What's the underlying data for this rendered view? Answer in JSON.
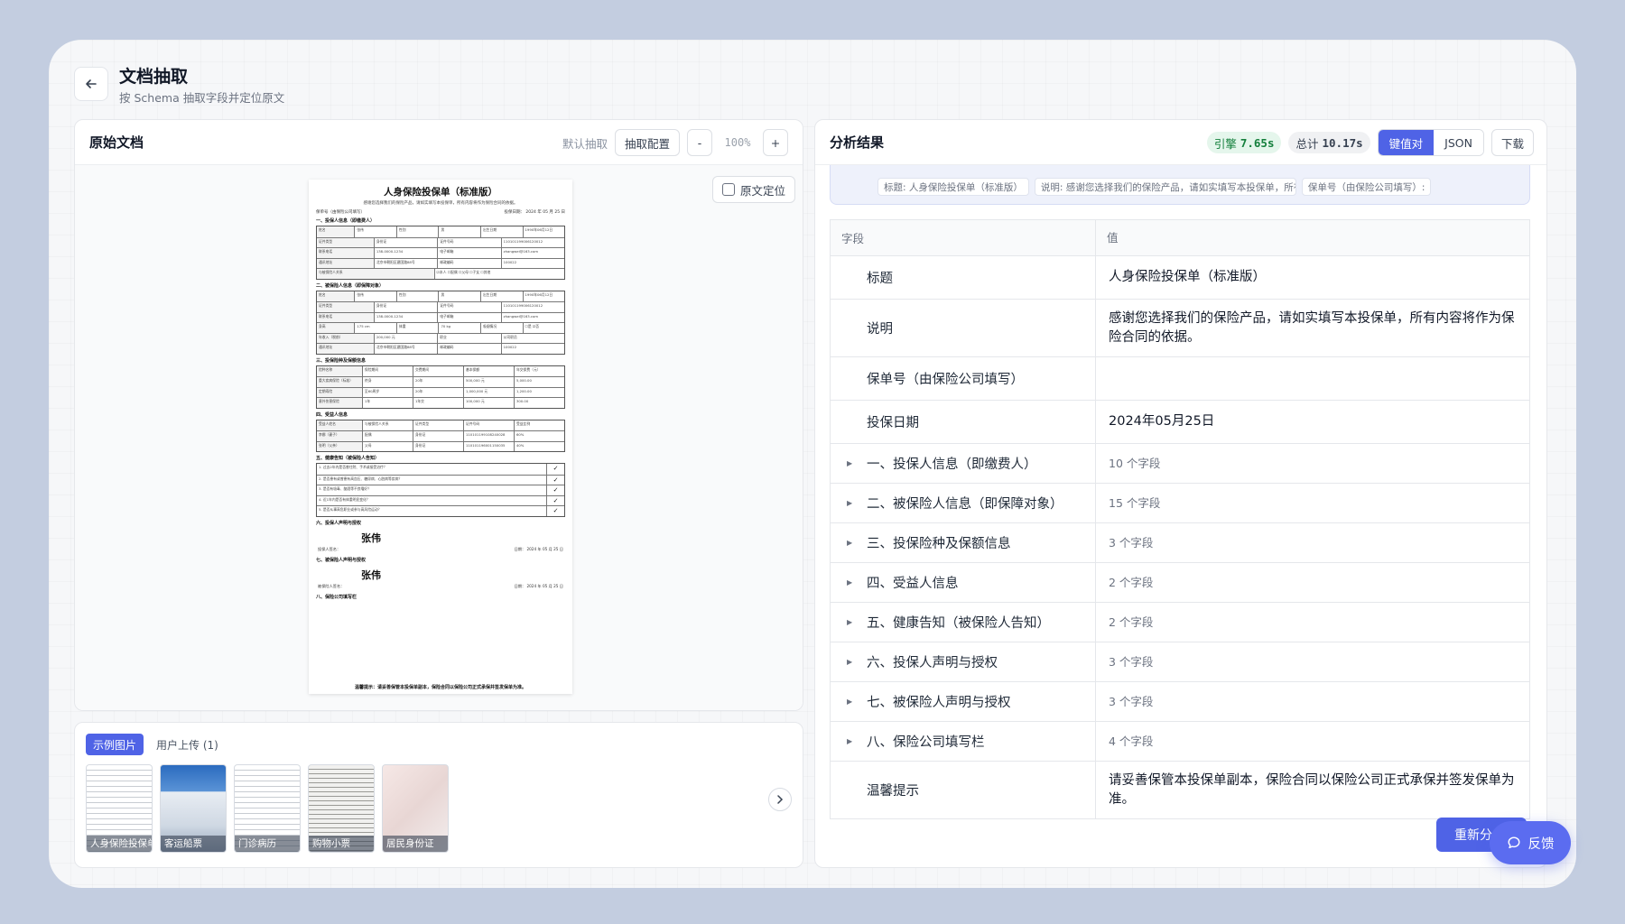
{
  "header": {
    "title": "文档抽取",
    "subtitle": "按 Schema 抽取字段并定位原文"
  },
  "left": {
    "title": "原始文档",
    "default_extract": "默认抽取",
    "config_button": "抽取配置",
    "zoom_minus": "-",
    "zoom": "100%",
    "zoom_plus": "+",
    "locate_label": "原文定位"
  },
  "doc": {
    "title": "人身保险投保单（标准版）",
    "subtitle": "感谢您选择我们的保险产品，请如实填写本投保单，所有内容将作为保险合同的依据。",
    "policy_no": "保单号（由保险公司填写）",
    "date": "投保日期：  2024 年 05 月 25 日",
    "s1": "一、投保人信息（即缴费人）",
    "s2": "二、被保险人信息（即保障对象）",
    "s3": "三、投保险种及保额信息",
    "s4": "四、受益人信息",
    "s5": "五、健康告知（被保险人告知）",
    "s6": "六、投保人声明与授权",
    "s7": "七、被保险人声明与授权",
    "s8": "八、保险公司填写栏",
    "r1": [
      "姓名",
      "张伟",
      "性别",
      "男",
      "出生日期",
      "1990年06月12日"
    ],
    "r2": [
      "证件类型",
      "身份证",
      "证件号码",
      "110101199006120012"
    ],
    "r3": [
      "联系电话",
      "138-0000-1234",
      "电子邮箱",
      "zhangwei@163.com"
    ],
    "r4": [
      "通讯地址",
      "北京市朝阳区建国路88号",
      "邮政编码",
      "100022"
    ],
    "r5": [
      "与被保险人关系",
      "☑本人 ☐配偶 ☐父母 ☐子女 ☐其他"
    ],
    "r6": [
      "身高",
      "175 cm",
      "体重",
      "70 kg",
      "吸烟情况",
      "☐是 ☑否"
    ],
    "r7": [
      "年收入（税前）",
      "200,000 元",
      "职业",
      "公司职员"
    ],
    "r8": [
      "险种名称",
      "保险期间",
      "交费期间",
      "基本保额",
      "年交保费（元）"
    ],
    "r9": [
      "重大疾病保险（标准）",
      "终身",
      "20年",
      "500,000 元",
      "5,000.00"
    ],
    "r10": [
      "定期寿险",
      "至60周岁",
      "20年",
      "1,000,000 元",
      "1,200.00"
    ],
    "r11": [
      "意外伤害保险",
      "1年",
      "1年交",
      "100,000 元",
      "300.00"
    ],
    "r12": [
      "受益人姓名",
      "与被保险人关系",
      "证件类型",
      "证件号码",
      "受益比例"
    ],
    "r13": [
      "李娜（妻子）",
      "配偶",
      "身份证",
      "110101199108240028",
      "60%"
    ],
    "r14": [
      "张明（父亲）",
      "父母",
      "身份证",
      "110101196001150035",
      "40%"
    ],
    "h1": "1. 过去2年内是否曾住院、手术或接受治疗？",
    "h2": "2. 是否患有或曾患有高血压、糖尿病、心脏病等疾病？",
    "h3": "3. 是否有吸毒、酗酒等不良嗜好？",
    "h4": "4. 近1年内是否有体重明显变化？",
    "h5": "5. 是否从事高危职业或参与高风险运动？",
    "sign1_label": "投保人签名：",
    "sign1": "张伟",
    "sign1_date": "日期：  2024 年 05 月 25 日",
    "sign2_label": "被保险人签名：",
    "sign2": "张伟",
    "sign2_date": "日期：  2024 年 05 月 25 日",
    "footer": "温馨提示：请妥善保管本投保单副本，保险合同以保险公司正式承保并签发保单为准。"
  },
  "samples": {
    "tab_examples": "示例图片",
    "tab_uploads": "用户上传 (1)",
    "items": [
      "人身保险投保单",
      "客运船票",
      "门诊病历",
      "购物小票",
      "居民身份证"
    ]
  },
  "right": {
    "title": "分析结果",
    "engine_label": "引擎",
    "engine_time": "7.65s",
    "total_label": "总计",
    "total_time": "10.17s",
    "view_kv": "键值对",
    "view_json": "JSON",
    "download": "下载",
    "chips": [
      "标题: 人身保险投保单（标准版）",
      "说明: 感谢您选择我们的保险产品，请如实填写本投保单，所有内容将作为保险合同的依据。",
      "保单号（由保险公司填写）:"
    ],
    "col_field": "字段",
    "col_value": "值",
    "rows": [
      {
        "k": "标题",
        "v": "人身保险投保单（标准版）"
      },
      {
        "k": "说明",
        "v": "感谢您选择我们的保险产品，请如实填写本投保单，所有内容将作为保险合同的依据。"
      },
      {
        "k": "保单号（由保险公司填写）",
        "v": ""
      },
      {
        "k": "投保日期",
        "v": "2024年05月25日"
      },
      {
        "k": "一、投保人信息（即缴费人）",
        "v": "10 个字段"
      },
      {
        "k": "二、被保险人信息（即保障对象）",
        "v": "15 个字段"
      },
      {
        "k": "三、投保险种及保额信息",
        "v": "3 个字段"
      },
      {
        "k": "四、受益人信息",
        "v": "2 个字段"
      },
      {
        "k": "五、健康告知（被保险人告知）",
        "v": "2 个字段"
      },
      {
        "k": "六、投保人声明与授权",
        "v": "3 个字段"
      },
      {
        "k": "七、被保险人声明与授权",
        "v": "3 个字段"
      },
      {
        "k": "八、保险公司填写栏",
        "v": "4 个字段"
      },
      {
        "k": "温馨提示",
        "v": "请妥善保管本投保单副本，保险合同以保险公司正式承保并签发保单为准。"
      }
    ],
    "redo": "重新分"
  },
  "feedback": "反馈",
  "colors": {
    "accent": "#4f63e6",
    "success": "#15803d",
    "background": "#c3cde0"
  }
}
